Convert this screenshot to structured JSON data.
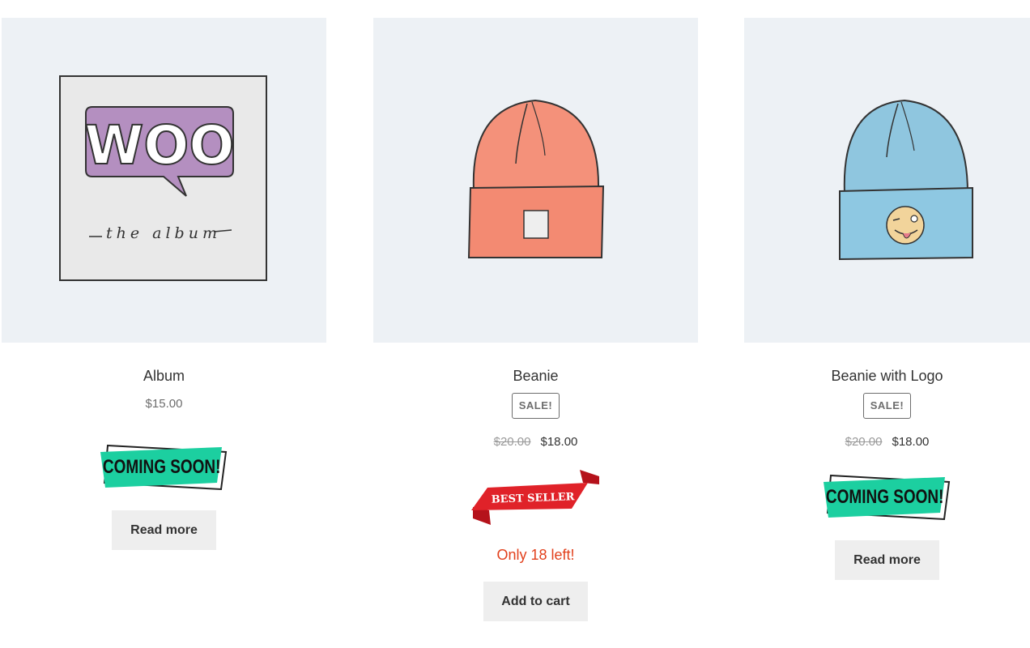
{
  "products": [
    {
      "name": "Album",
      "price": "$15.00",
      "badge": "COMING SOON!",
      "badge_color": "#1ccfa0",
      "button": "Read more"
    },
    {
      "name": "Beanie",
      "sale_label": "SALE!",
      "price_old": "$20.00",
      "price_new": "$18.00",
      "badge": "BEST SELLER",
      "badge_color": "#e02229",
      "stock": "Only 18 left!",
      "button": "Add to cart"
    },
    {
      "name": "Beanie with Logo",
      "sale_label": "SALE!",
      "price_old": "$20.00",
      "price_new": "$18.00",
      "badge": "COMING SOON!",
      "badge_color": "#1ccfa0",
      "button": "Read more"
    }
  ],
  "artwork": {
    "album_logo": "WOO",
    "album_caption": "the album"
  }
}
